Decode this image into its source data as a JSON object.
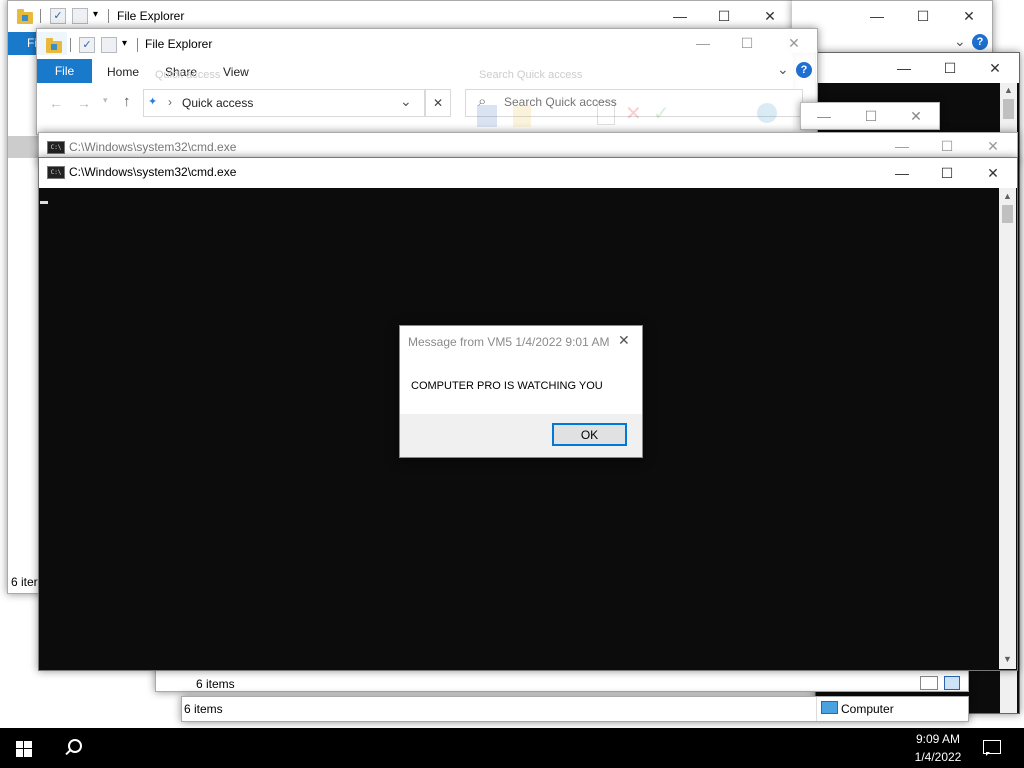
{
  "colors": {
    "accent": "#0078d7",
    "console_bg": "#0c0c0c",
    "taskbar_bg": "#000000",
    "help_blue": "#1e6fd0"
  },
  "explorer_back": {
    "title": "File Explorer",
    "file_tab": "Fi",
    "status": "6 iter"
  },
  "explorer_front": {
    "title": "File Explorer",
    "tabs": {
      "file": "File",
      "home": "Home",
      "share": "Share",
      "view": "View"
    },
    "address": "Quick access",
    "search_placeholder": "Search Quick access",
    "help": "?"
  },
  "explorer_ghost": {
    "address_ghost": "Quick access",
    "search_ghost": "Search Quick access"
  },
  "cmd_back": {
    "title": "C:\\Windows\\system32\\cmd.exe",
    "icon": "C:\\"
  },
  "cmd_front": {
    "title": "C:\\Windows\\system32\\cmd.exe",
    "icon": "C:\\"
  },
  "status_windows": {
    "items_upper": "6 items",
    "items_lower": "6 items",
    "computer": "Computer"
  },
  "dialog": {
    "title": "Message from VM5 1/4/2022 9:01 AM",
    "message": "COMPUTER PRO IS WATCHING YOU",
    "ok": "OK"
  },
  "taskbar": {
    "time": "9:09 AM",
    "date": "1/4/2022",
    "icons": [
      "windows-start-icon",
      "search-icon",
      "notification-icon"
    ]
  },
  "glyphs": {
    "minimize": "—",
    "maximize": "☐",
    "close": "✕",
    "chevron_down": "⌄",
    "up_arrow": "↑",
    "back_arrow": "←",
    "forward_arrow": "→",
    "pin": "📌",
    "search": "⌕",
    "scroll_up": "▲",
    "scroll_down": "▼",
    "qa_dropdown": "▾",
    "breadcrumb_sep": "›",
    "check": "✓"
  }
}
